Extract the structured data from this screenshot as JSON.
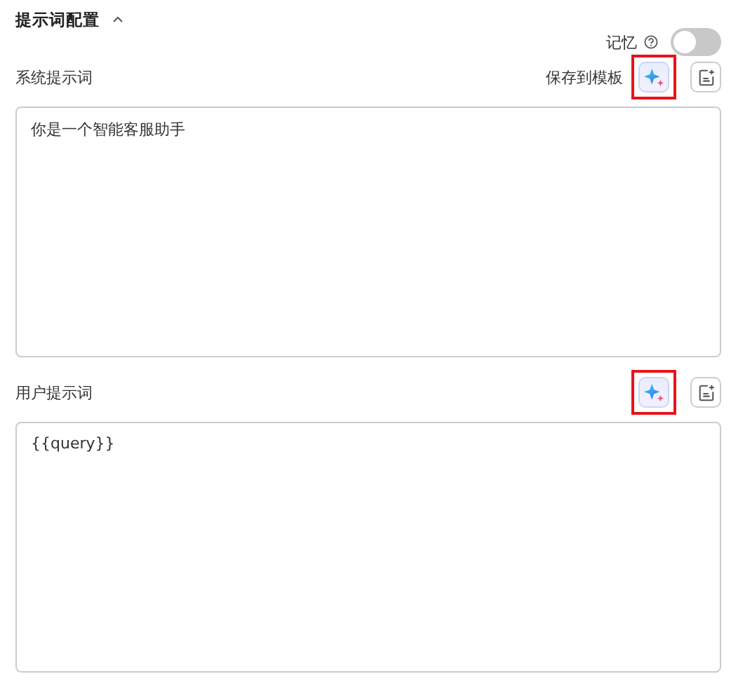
{
  "section": {
    "title": "提示词配置",
    "expanded": true
  },
  "memory": {
    "label": "记忆",
    "on": false
  },
  "prompts": [
    {
      "label": "系统提示词",
      "save_link": "保存到模板",
      "value": "你是一个智能客服助手",
      "highlighted": true
    },
    {
      "label": "用户提示词",
      "value": "{{query}}",
      "highlighted": true
    }
  ]
}
